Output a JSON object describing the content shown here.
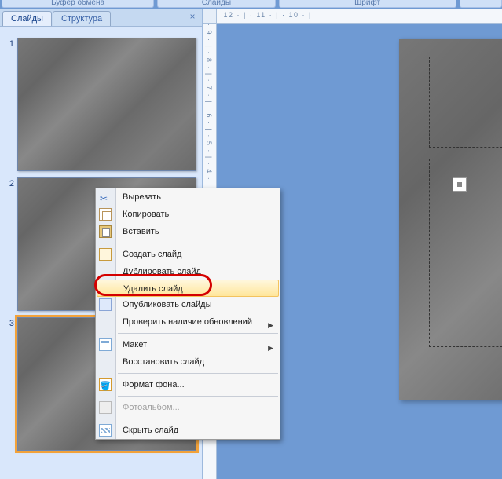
{
  "ribbon_groups": {
    "g1": "Буфер обмена",
    "g2": "Слайды",
    "g3": "Шрифт",
    "g4": ""
  },
  "side": {
    "tab_slides": "Слайды",
    "tab_outline": "Структура",
    "close": "×",
    "slides": [
      {
        "num": "1",
        "title": ""
      },
      {
        "num": "2",
        "title": ""
      },
      {
        "num": "3",
        "title": ""
      }
    ]
  },
  "ruler_h": "· 12 · | · 11 · | · 10 · |",
  "ruler_v": "· 9 · | · 8 · | · 7 · | · 6 · | · 5 · | · 4 · | · 3 · | · 2 · | · 1 · |",
  "ctx": {
    "cut": "Вырезать",
    "copy": "Копировать",
    "paste": "Вставить",
    "new": "Создать слайд",
    "dup": "Дублировать слайд",
    "del": "Удалить слайд",
    "pub": "Опубликовать слайды",
    "check": "Проверить наличие обновлений",
    "layout": "Макет",
    "reset": "Восстановить слайд",
    "format": "Формат фона...",
    "album": "Фотоальбом...",
    "hide": "Скрыть слайд"
  }
}
